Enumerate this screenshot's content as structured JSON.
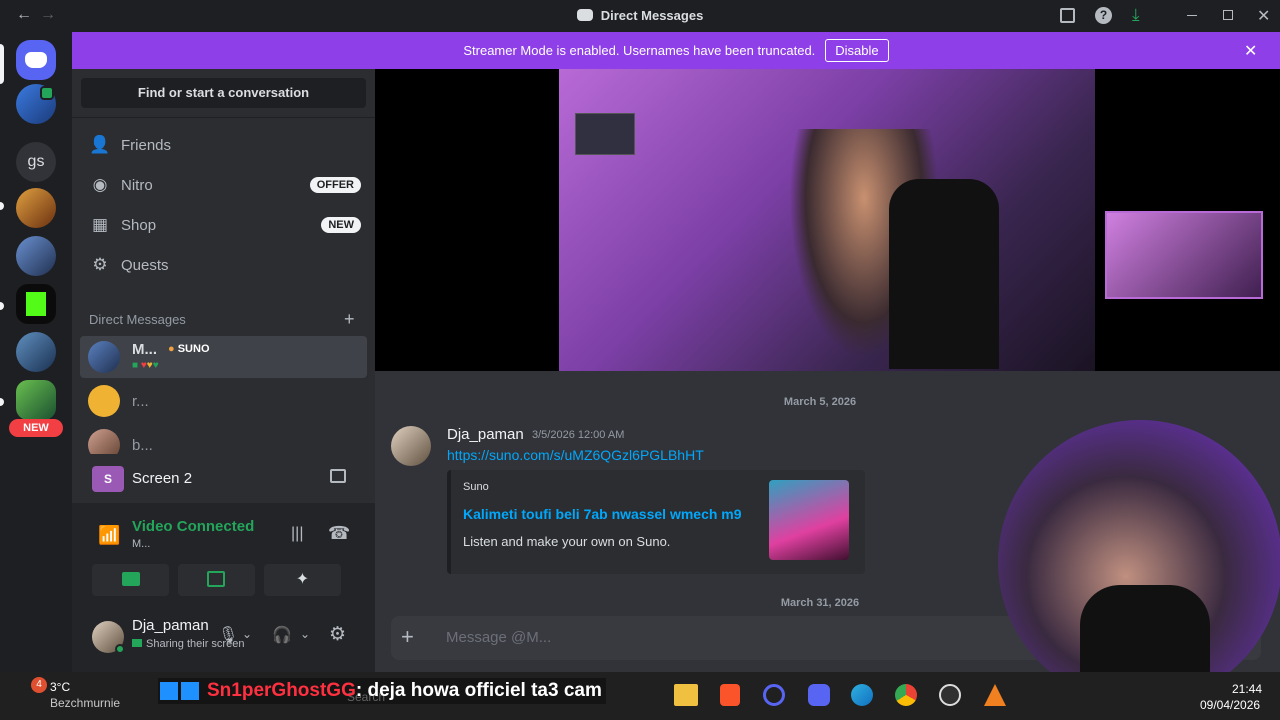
{
  "window": {
    "title": "Direct Messages"
  },
  "banner": {
    "text": "Streamer Mode is enabled. Usernames have been truncated.",
    "button": "Disable"
  },
  "rail": {
    "new_badge": "NEW",
    "text_server": "gs"
  },
  "sidebar": {
    "search_placeholder": "Find or start a conversation",
    "nav": [
      {
        "label": "Friends",
        "icon": "friends-icon"
      },
      {
        "label": "Nitro",
        "icon": "nitro-icon",
        "badge": "OFFER"
      },
      {
        "label": "Shop",
        "icon": "shop-icon",
        "badge": "NEW"
      },
      {
        "label": "Quests",
        "icon": "quests-icon"
      }
    ],
    "dm_header": "Direct Messages",
    "dms": [
      {
        "name": "M...",
        "tag": "SUNO"
      },
      {
        "name": "r..."
      },
      {
        "name": "b..."
      }
    ]
  },
  "voice": {
    "screen_title": "Screen 2",
    "screen_initial": "S",
    "status": "Video Connected",
    "channel": "M...",
    "user": {
      "name": "Dja_paman",
      "status": "Sharing their screen"
    }
  },
  "chat": {
    "date1": "March 5, 2026",
    "message": {
      "author": "Dja_paman",
      "timestamp": "3/5/2026 12:00 AM",
      "link": "https://suno.com/s/uMZ6QGzl6PGLBhHT"
    },
    "embed": {
      "provider": "Suno",
      "title": "Kalimeti toufi beli 7ab nwassel wmech m9",
      "description": "Listen and make your own on Suno."
    },
    "date2": "March 31, 2026",
    "composer_placeholder": "Message @M..."
  },
  "overlay": {
    "caption_user": "Sn1perGhostGG",
    "caption_text": ": deja howa officiel ta3 cam"
  },
  "taskbar": {
    "temp": "3°C",
    "weather_label": "Bezchmurnie",
    "time": "21:44",
    "date": "09/04/2026",
    "search": "Search",
    "weather_alert": "4"
  },
  "colors": {
    "accent": "#5865f2",
    "banner": "#8f3fe8",
    "link": "#00a8fc",
    "green": "#23a55a"
  }
}
